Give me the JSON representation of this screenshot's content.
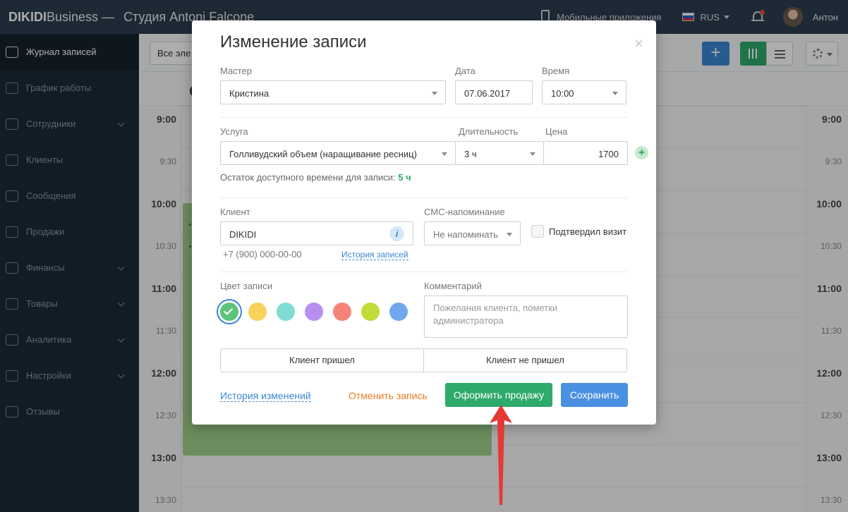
{
  "topbar": {
    "brand_bold": "DIKIDI",
    "brand_light": "Business —",
    "studio": "Студия Antoni Falcone",
    "mobile_apps": "Мобильные приложения",
    "lang": "RUS",
    "user_name": "Антон"
  },
  "sidebar": {
    "items": [
      {
        "label": "Журнал записей",
        "active": true
      },
      {
        "label": "График работы"
      },
      {
        "label": "Сотрудники",
        "chevron": true
      },
      {
        "label": "Клиенты"
      },
      {
        "label": "Сообщения"
      },
      {
        "label": "Продажи"
      },
      {
        "label": "Финансы",
        "chevron": true
      },
      {
        "label": "Товары",
        "chevron": true
      },
      {
        "label": "Аналитика",
        "chevron": true
      },
      {
        "label": "Настройки",
        "chevron": true
      },
      {
        "label": "Отзывы"
      }
    ]
  },
  "toolbar": {
    "filter_value": "Все эле",
    "add_label": "+"
  },
  "calendar": {
    "times_left": [
      "9:00",
      "9:30",
      "10:00",
      "10:30",
      "11:00",
      "11:30",
      "12:00",
      "12:30",
      "13:00",
      "13:30"
    ],
    "times_right": [
      "9:00",
      "9:30",
      "10:00",
      "10:30",
      "11:00",
      "11:30",
      "12:00",
      "12:30",
      "13:00",
      "13:30"
    ]
  },
  "modal": {
    "title": "Изменение записи",
    "close": "×",
    "master_label": "Мастер",
    "master_value": "Кристина",
    "date_label": "Дата",
    "date_value": "07.06.2017",
    "time_label": "Время",
    "time_value": "10:00",
    "service_label": "Услуга",
    "service_value": "Голливудский объем (наращивание ресниц)",
    "duration_label": "Длительность",
    "duration_value": "3 ч",
    "price_label": "Цена",
    "price_value": "1700",
    "add_service": "+",
    "remaining_label": "Остаток доступного времени для записи: ",
    "remaining_value": "5 ч",
    "client_label": "Клиент",
    "client_value": "DIKIDI",
    "client_phone": "+7 (900) 000-00-00",
    "history_link": "История записей",
    "sms_label": "СМС-напоминание",
    "sms_value": "Не напоминать",
    "confirm_label": "Подтвердил визит",
    "color_label": "Цвет записи",
    "colors": [
      "#5cc37a",
      "#f9d25b",
      "#7fdcd0",
      "#b68ff0",
      "#f58378",
      "#c2dc3a",
      "#6fa8ee"
    ],
    "selected_color": 0,
    "comment_label": "Комментарий",
    "comment_placeholder": "Пожелания клиента, пометки администратора",
    "came_label": "Клиент пришел",
    "not_came_label": "Клиент не пришел",
    "changes_history": "История изменений",
    "cancel_record": "Отменить запись",
    "sell_label": "Оформить продажу",
    "save_label": "Сохранить"
  }
}
